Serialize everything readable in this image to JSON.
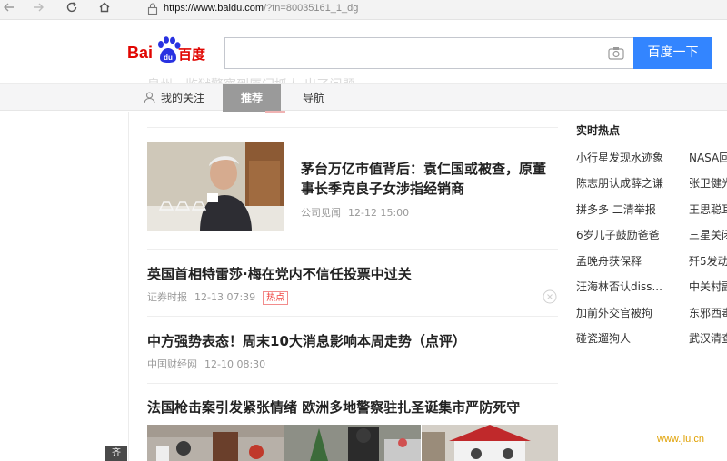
{
  "browser": {
    "back_icon": "arrow-left-icon",
    "forward_icon": "arrow-right-icon",
    "reload_icon": "reload-icon",
    "home_icon": "home-icon",
    "url_host": "https://www.baidu.com",
    "url_path": "/?tn=80035161_1_dg"
  },
  "header": {
    "logo_left": "Bai",
    "logo_mid": "du",
    "logo_right": "百度",
    "search_value": "",
    "search_button": "百度一下"
  },
  "tabs": {
    "ghost_text": "泉州一监狱警察到厦门抓人 出了问题",
    "mine": "我的关注",
    "recommend": "推荐",
    "nav": "导航"
  },
  "feed": [
    {
      "title_line1": "茅台万亿市值背后：袁仁国或被查，原董",
      "title_line2": "事长季克良子女涉指经销商",
      "source": "公司见闻",
      "time": "12-12 15:00"
    },
    {
      "title": "英国首相特雷莎·梅在党内不信任投票中过关",
      "source": "证券时报",
      "time": "12-13 07:39",
      "tag": "热点"
    },
    {
      "title": "中方强势表态！周末10大消息影响本周走势（点评）",
      "source": "中国财经网",
      "time": "12-10 08:30"
    },
    {
      "title": "法国枪击案引发紧张情绪 欧洲多地警察驻扎圣诞集市严防死守"
    }
  ],
  "hot": {
    "title": "实时热点",
    "col1": [
      "小行星发现水迹象",
      "陈志朋认成薛之谦",
      "拼多多 二清举报",
      "6岁儿子鼓励爸爸",
      "孟晚舟获保释",
      "汪海林否认diss...",
      "加前外交官被拘",
      "碰瓷遛狗人"
    ],
    "col2": [
      "NASA回",
      "张卫健光",
      "王思聪耳",
      "三星关闭",
      "歼5发动",
      "中关村副",
      "东邪西毒",
      "武汉清查"
    ]
  },
  "side_tab": "齐",
  "watermark": "www.jiu.cn",
  "colors": {
    "brand_red": "#e10602",
    "brand_blue": "#3385ff",
    "hot_red": "#f0433f"
  }
}
